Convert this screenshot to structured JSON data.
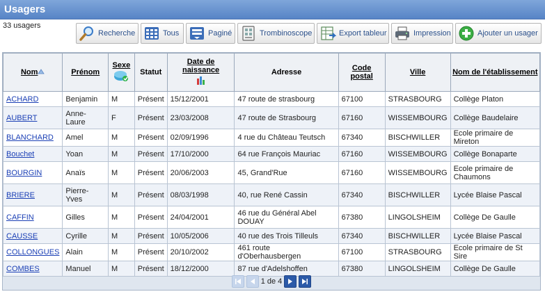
{
  "title": "Usagers",
  "count_text": "33 usagers",
  "toolbar": [
    {
      "label": "Recherche",
      "icon": "magnifier-icon"
    },
    {
      "label": "Tous",
      "icon": "grid-all-icon"
    },
    {
      "label": "Paginé",
      "icon": "grid-paged-icon"
    },
    {
      "label": "Trombinoscope",
      "icon": "contacts-icon"
    },
    {
      "label": "Export tableur",
      "icon": "spreadsheet-export-icon"
    },
    {
      "label": "Impression",
      "icon": "printer-icon"
    },
    {
      "label": "Ajouter un usager",
      "icon": "add-circle-icon"
    }
  ],
  "columns": {
    "nom": "Nom",
    "prenom": "Prénom",
    "sexe": "Sexe",
    "statut": "Statut",
    "date_naissance": "Date de naissance",
    "adresse": "Adresse",
    "code_postal": "Code postal",
    "ville": "Ville",
    "etablissement": "Nom de l'établissement"
  },
  "rows": [
    {
      "nom": "ACHARD",
      "prenom": "Benjamin",
      "sexe": "M",
      "statut": "Présent",
      "date": "15/12/2001",
      "adresse": "47 route de strasbourg",
      "cp": "67100",
      "ville": "STRASBOURG",
      "etab": "Collège Platon"
    },
    {
      "nom": "AUBERT",
      "prenom": "Anne-Laure",
      "sexe": "F",
      "statut": "Présent",
      "date": "23/03/2008",
      "adresse": "47 route de Strasbourg",
      "cp": "67160",
      "ville": "WISSEMBOURG",
      "etab": "Collège Baudelaire"
    },
    {
      "nom": "BLANCHARD",
      "prenom": "Amel",
      "sexe": "M",
      "statut": "Présent",
      "date": "02/09/1996",
      "adresse": "4 rue du Château Teutsch",
      "cp": "67340",
      "ville": "BISCHWILLER",
      "etab": "Ecole primaire de Mireton"
    },
    {
      "nom": "Bouchet",
      "prenom": "Yoan",
      "sexe": "M",
      "statut": "Présent",
      "date": "17/10/2000",
      "adresse": "64 rue François Mauriac",
      "cp": "67160",
      "ville": "WISSEMBOURG",
      "etab": "Collège Bonaparte"
    },
    {
      "nom": "BOURGIN",
      "prenom": "Anaïs",
      "sexe": "M",
      "statut": "Présent",
      "date": "20/06/2003",
      "adresse": "45, Grand'Rue",
      "cp": "67160",
      "ville": "WISSEMBOURG",
      "etab": "Ecole primaire de Chaumons"
    },
    {
      "nom": "BRIERE",
      "prenom": "Pierre-Yves",
      "sexe": "M",
      "statut": "Présent",
      "date": "08/03/1998",
      "adresse": "40, rue René Cassin",
      "cp": "67340",
      "ville": "BISCHWILLER",
      "etab": "Lycée Blaise Pascal"
    },
    {
      "nom": "CAFFIN",
      "prenom": "Gilles",
      "sexe": "M",
      "statut": "Présent",
      "date": "24/04/2001",
      "adresse": "46 rue du Général Abel DOUAY",
      "cp": "67380",
      "ville": "LINGOLSHEIM",
      "etab": "Collège De Gaulle"
    },
    {
      "nom": "CAUSSE",
      "prenom": "Cyrille",
      "sexe": "M",
      "statut": "Présent",
      "date": "10/05/2006",
      "adresse": "40 rue des Trois Tilleuls",
      "cp": "67340",
      "ville": "BISCHWILLER",
      "etab": "Lycée Blaise Pascal"
    },
    {
      "nom": "COLLONGUES",
      "prenom": "Alain",
      "sexe": "M",
      "statut": "Présent",
      "date": "20/10/2002",
      "adresse": "461 route d'Oberhausbergen",
      "cp": "67100",
      "ville": "STRASBOURG",
      "etab": "Ecole primaire de St Sire"
    },
    {
      "nom": "COMBES",
      "prenom": "Manuel",
      "sexe": "M",
      "statut": "Présent",
      "date": "18/12/2000",
      "adresse": "87 rue d'Adelshoffen",
      "cp": "67380",
      "ville": "LINGOLSHEIM",
      "etab": "Collège De Gaulle"
    }
  ],
  "pager": {
    "text": "1 de 4"
  },
  "colors": {
    "title_bar": "#5784c6",
    "link": "#1a3fb5",
    "row_alt": "#eef2f8"
  }
}
